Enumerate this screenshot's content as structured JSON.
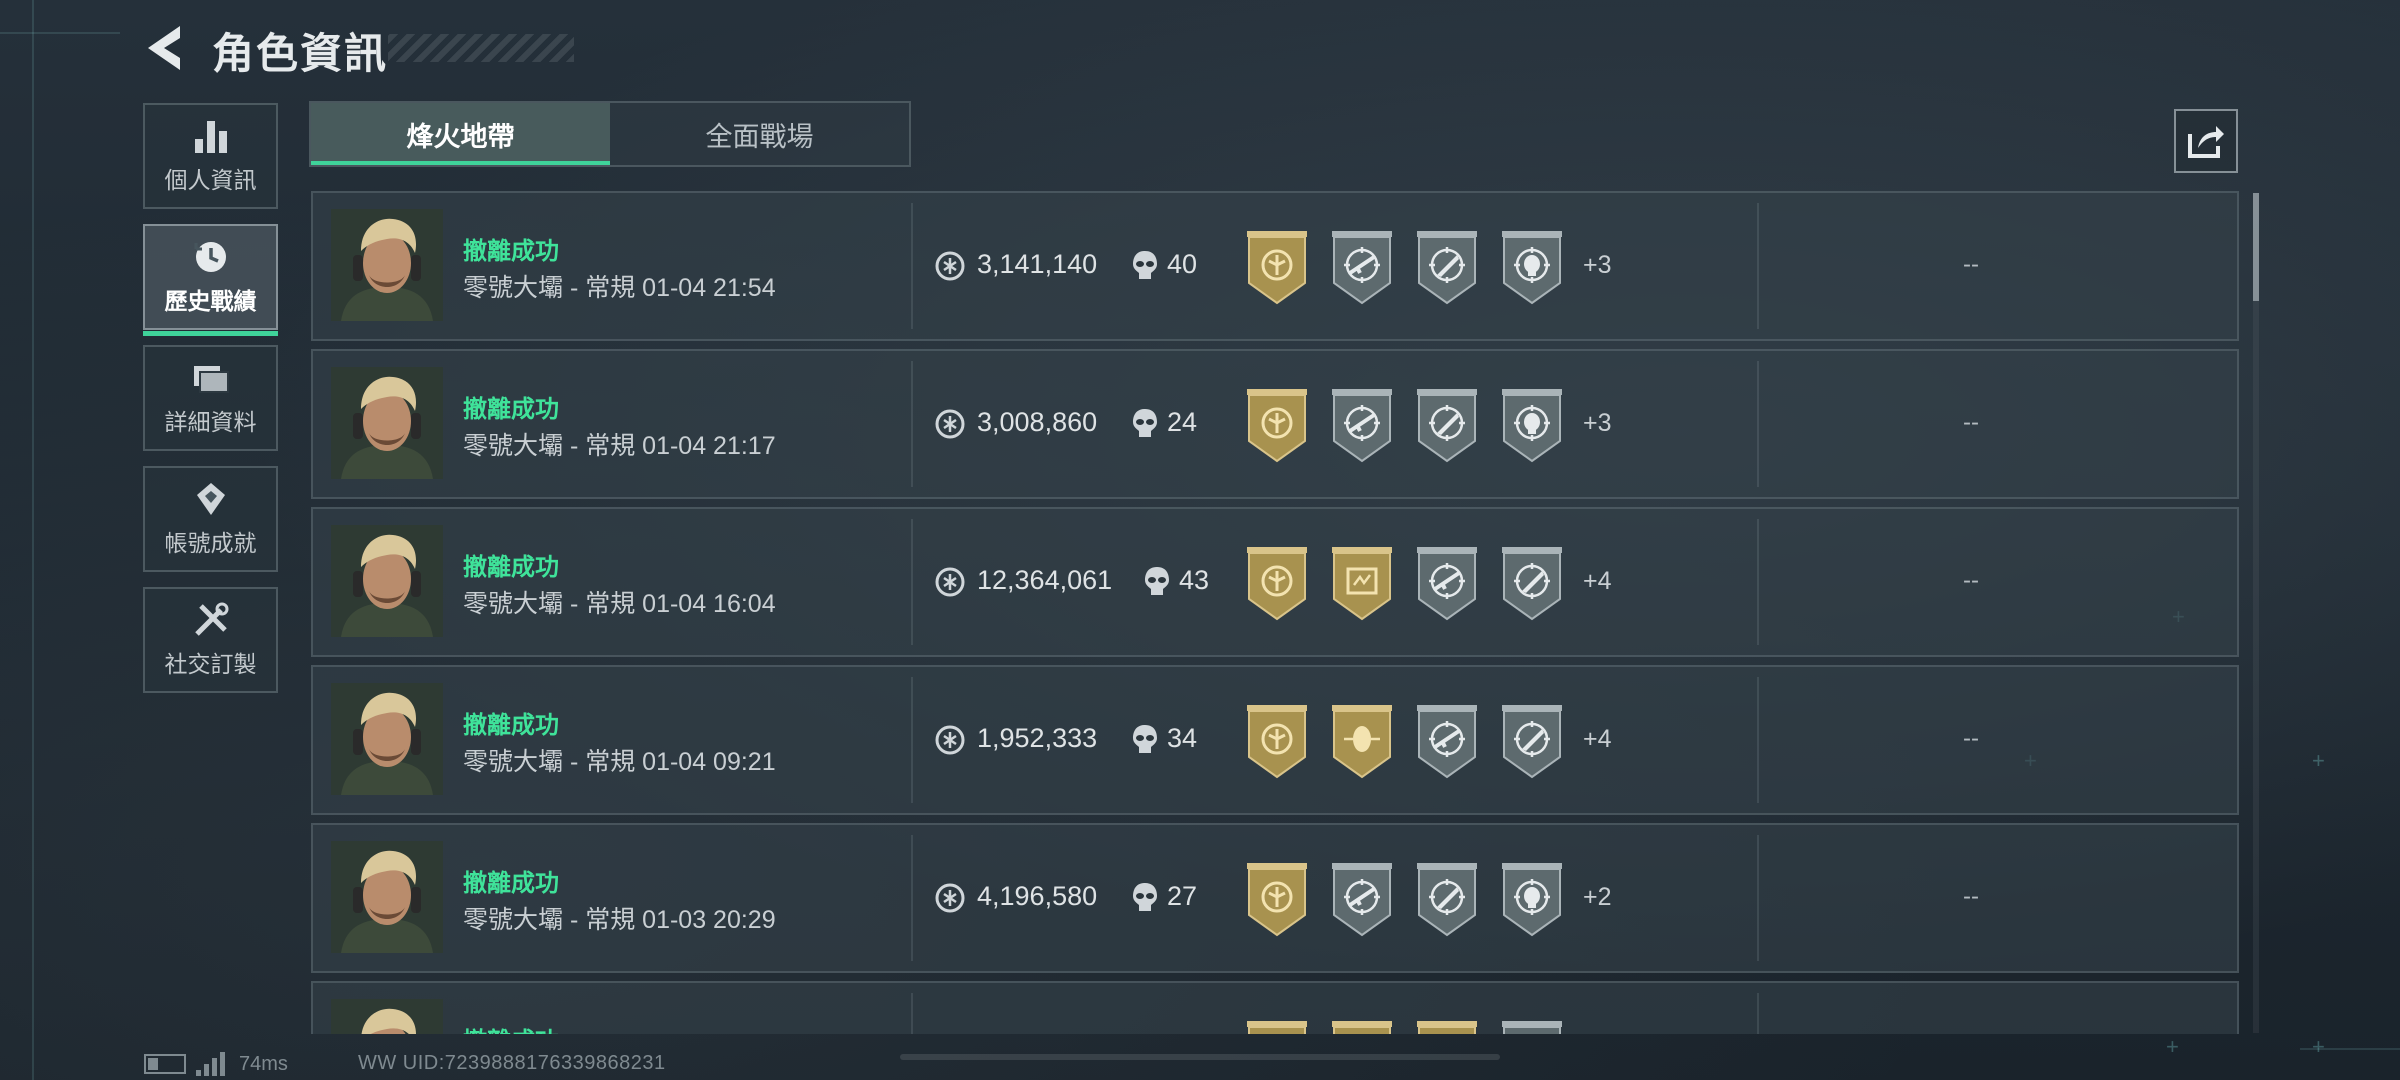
{
  "header": {
    "title": "角色資訊"
  },
  "sidebar": {
    "items": [
      {
        "label": "個人資訊",
        "icon": "bar-chart-icon",
        "active": false
      },
      {
        "label": "歷史戰績",
        "icon": "history-clock-icon",
        "active": true
      },
      {
        "label": "詳細資料",
        "icon": "folder-icon",
        "active": false
      },
      {
        "label": "帳號成就",
        "icon": "achievement-icon",
        "active": false
      },
      {
        "label": "社交訂製",
        "icon": "tools-icon",
        "active": false
      }
    ]
  },
  "tabs": [
    {
      "label": "烽火地帶",
      "active": true
    },
    {
      "label": "全面戰場",
      "active": false
    }
  ],
  "share": {
    "icon": "share-icon"
  },
  "records": [
    {
      "status": "撤離成功",
      "meta": "零號大壩 - 常規 01-04 21:54",
      "value": "3,141,140",
      "kills": "40",
      "badges": [
        "gold-emblem",
        "gray-rifle",
        "gray-knife",
        "gray-skull"
      ],
      "more": "+3",
      "extra": "--"
    },
    {
      "status": "撤離成功",
      "meta": "零號大壩 - 常規 01-04 21:17",
      "value": "3,008,860",
      "kills": "24",
      "badges": [
        "gold-emblem",
        "gray-rifle",
        "gray-knife",
        "gray-skull"
      ],
      "more": "+3",
      "extra": "--"
    },
    {
      "status": "撤離成功",
      "meta": "零號大壩 - 常規 01-04 16:04",
      "value": "12,364,061",
      "kills": "43",
      "badges": [
        "gold-emblem",
        "gold-monitor",
        "gray-rifle",
        "gray-knife"
      ],
      "more": "+4",
      "extra": "--"
    },
    {
      "status": "撤離成功",
      "meta": "零號大壩 - 常規 01-04 09:21",
      "value": "1,952,333",
      "kills": "34",
      "badges": [
        "gold-emblem",
        "gold-mask",
        "gray-rifle",
        "gray-knife"
      ],
      "more": "+4",
      "extra": "--"
    },
    {
      "status": "撤離成功",
      "meta": "零號大壩 - 常規 01-03 20:29",
      "value": "4,196,580",
      "kills": "27",
      "badges": [
        "gold-emblem",
        "gray-rifle",
        "gray-knife",
        "gray-skull"
      ],
      "more": "+2",
      "extra": "--"
    },
    {
      "status": "撤離成功",
      "meta": "",
      "value": "",
      "kills": "",
      "badges": [
        "gold-emblem",
        "gold-mask",
        "gold-emblem",
        "gray-skull"
      ],
      "more": "",
      "extra": ""
    }
  ],
  "footer": {
    "ping": "74ms",
    "uid": "WW UID:7239888176339868231"
  },
  "colors": {
    "accent": "#3fd39a",
    "status": "#3fe39a",
    "gold": "#a8924f",
    "gray_badge": "#5d6a6e"
  }
}
